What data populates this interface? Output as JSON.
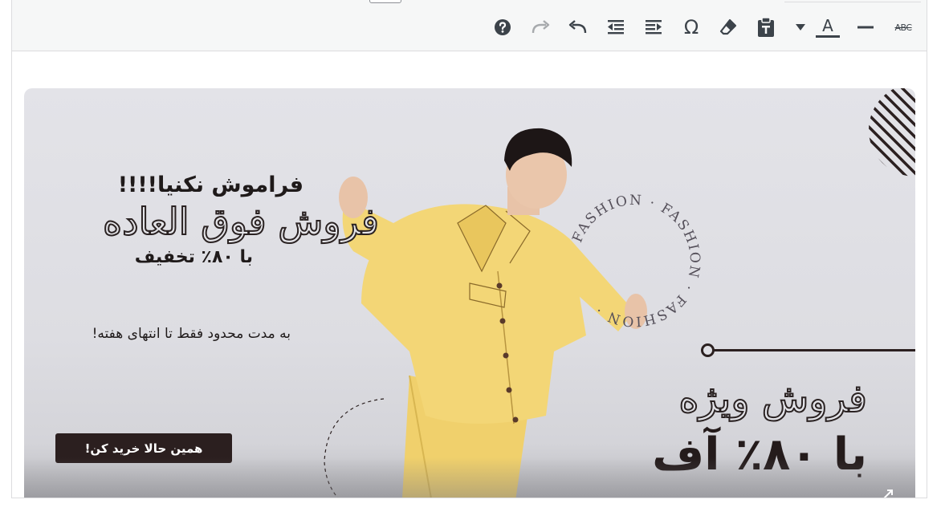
{
  "toolbar": {
    "buttons": [
      {
        "name": "help-button",
        "icon": "question-circle-icon"
      },
      {
        "name": "redo-button",
        "icon": "redo-icon",
        "disabled": true
      },
      {
        "name": "undo-button",
        "icon": "undo-icon"
      },
      {
        "name": "outdent-button",
        "icon": "outdent-icon"
      },
      {
        "name": "indent-button",
        "icon": "indent-icon"
      },
      {
        "name": "special-character-button",
        "icon": "omega-icon",
        "glyph": "Ω"
      },
      {
        "name": "clear-formatting-button",
        "icon": "eraser-icon"
      },
      {
        "name": "paste-as-text-button",
        "icon": "paste-text-icon"
      },
      {
        "name": "text-color-dropdown",
        "icon": "caret-down-icon"
      },
      {
        "name": "text-color-button",
        "icon": "text-color-icon",
        "glyph": "A"
      },
      {
        "name": "horizontal-line-button",
        "icon": "horizontal-line-icon"
      },
      {
        "name": "strikethrough-button",
        "icon": "strikethrough-icon",
        "glyph": "ABC"
      }
    ],
    "colors": {
      "icon": "#3c434a",
      "icon_disabled": "#a7aaad",
      "background": "#f6f7f7"
    }
  },
  "banner": {
    "headline_1": "فراموش نکنیا!!!!",
    "headline_2": "فروش فوق العاده",
    "headline_3": "با ۸۰٪ تخفیف",
    "subtext": "به مدت محدود فقط تا انتهای هفته!",
    "cta_label": "همین حالا خرید کن!",
    "big_title_1": "فروش ویژه",
    "big_title_2": "با ۸۰٪ آف",
    "ring_text": "FASHION · FASHION · FASHION · ",
    "colors": {
      "dark": "#2b1f1f",
      "shirt": "#f3d676",
      "background": "#e0e0e5"
    }
  }
}
